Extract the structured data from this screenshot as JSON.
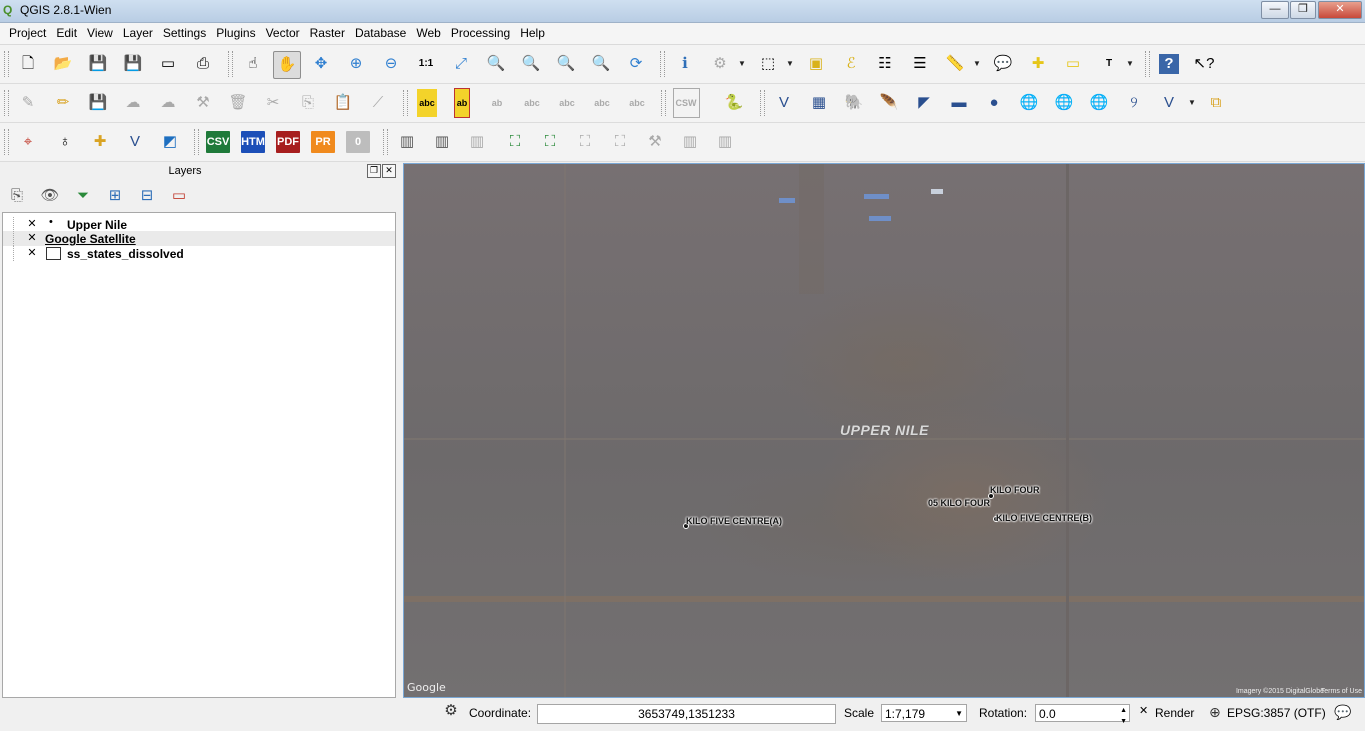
{
  "window": {
    "title": "QGIS 2.8.1-Wien",
    "minimize": "—",
    "maximize": "❐",
    "close": "✕"
  },
  "menu": [
    "Project",
    "Edit",
    "View",
    "Layer",
    "Settings",
    "Plugins",
    "Vector",
    "Raster",
    "Database",
    "Web",
    "Processing",
    "Help"
  ],
  "toolbar3_badges": {
    "csv": "CSV",
    "htm": "HTM",
    "pdf": "PDF",
    "pr": "PR",
    "zero": "0"
  },
  "colors": {
    "csv": "#1f7a3a",
    "htm": "#1c4fb8",
    "pdf": "#a71e1e",
    "pr": "#f08a1d",
    "zero": "#bdbdbd"
  },
  "layers_panel": {
    "title": "Layers",
    "items": [
      {
        "name": "Upper Nile",
        "checked": true,
        "symbol": "point"
      },
      {
        "name": "Google Satellite",
        "checked": true,
        "symbol": "none"
      },
      {
        "name": "ss_states_dissolved",
        "checked": true,
        "symbol": "polygon"
      }
    ]
  },
  "map": {
    "region_label": "UPPER NILE",
    "labels": [
      "KILO FOUR",
      "05 KILO FOUR",
      "KILO FIVE CENTRE(B)",
      "KILO FIVE CENTRE(A)"
    ],
    "google": "Google",
    "imagery": "Imagery ©2015 DigitalGlobe",
    "terms": "Terms of Use"
  },
  "status": {
    "coordinate_label": "Coordinate:",
    "coordinate": "3653749,1351233",
    "scale_label": "Scale",
    "scale": "1:7,179",
    "rotation_label": "Rotation:",
    "rotation": "0.0",
    "render_label": "Render",
    "render_checked": "✕",
    "crs": "EPSG:3857 (OTF)"
  }
}
